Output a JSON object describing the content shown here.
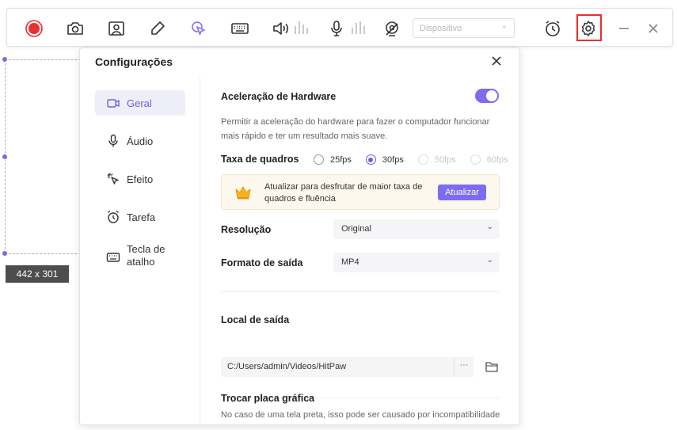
{
  "toolbar": {
    "items": [
      "record-icon",
      "camera-icon",
      "webcam-icon",
      "pen-icon",
      "cursor-click-icon",
      "keyboard-icon",
      "speaker-icon",
      "microphone-icon",
      "webcam-settings-icon"
    ],
    "device_placeholder": "Dispositivo",
    "right_items": [
      "alarm-clock-icon",
      "gear-icon",
      "minimize-icon",
      "close-icon"
    ],
    "accent": "#e8302f"
  },
  "selection": {
    "size_label": "442 x 301"
  },
  "dialog": {
    "title": "Configurações",
    "sidebar": [
      {
        "label": "Geral",
        "icon": "camera-icon",
        "active": true
      },
      {
        "label": "Áudio",
        "icon": "microphone-icon",
        "active": false
      },
      {
        "label": "Efeito",
        "icon": "cursor-click-icon",
        "active": false
      },
      {
        "label": "Tarefa",
        "icon": "alarm-clock-icon",
        "active": false
      },
      {
        "label": "Tecla de atalho",
        "icon": "keyboard-icon",
        "active": false
      }
    ],
    "general": {
      "hw_accel": {
        "title": "Aceleração de Hardware",
        "enabled": true,
        "description": "Permitir a aceleração do hardware para fazer o computador funcionar mais rápido e ter um resultado mais suave."
      },
      "framerate": {
        "title": "Taxa de quadros",
        "options": [
          "25fps",
          "30fps",
          "50fps",
          "60fps"
        ],
        "selected": "30fps"
      },
      "upgrade": {
        "text": "Atualizar para desfrutar de maior taxa de quadros e fluência",
        "button": "Atualizar"
      },
      "resolution": {
        "title": "Resolução",
        "value": "Original"
      },
      "output_format": {
        "title": "Formato de saída",
        "value": "MP4"
      },
      "output_location": {
        "title": "Local de saída",
        "path": "C:/Users/admin/Videos/HitPaw",
        "more_label": "···"
      },
      "gpu": {
        "title": "Trocar placa gráfica",
        "description": "No caso de uma tela preta, isso pode ser causado por incompatibilidade"
      }
    },
    "accent": "#7d6cf0"
  }
}
